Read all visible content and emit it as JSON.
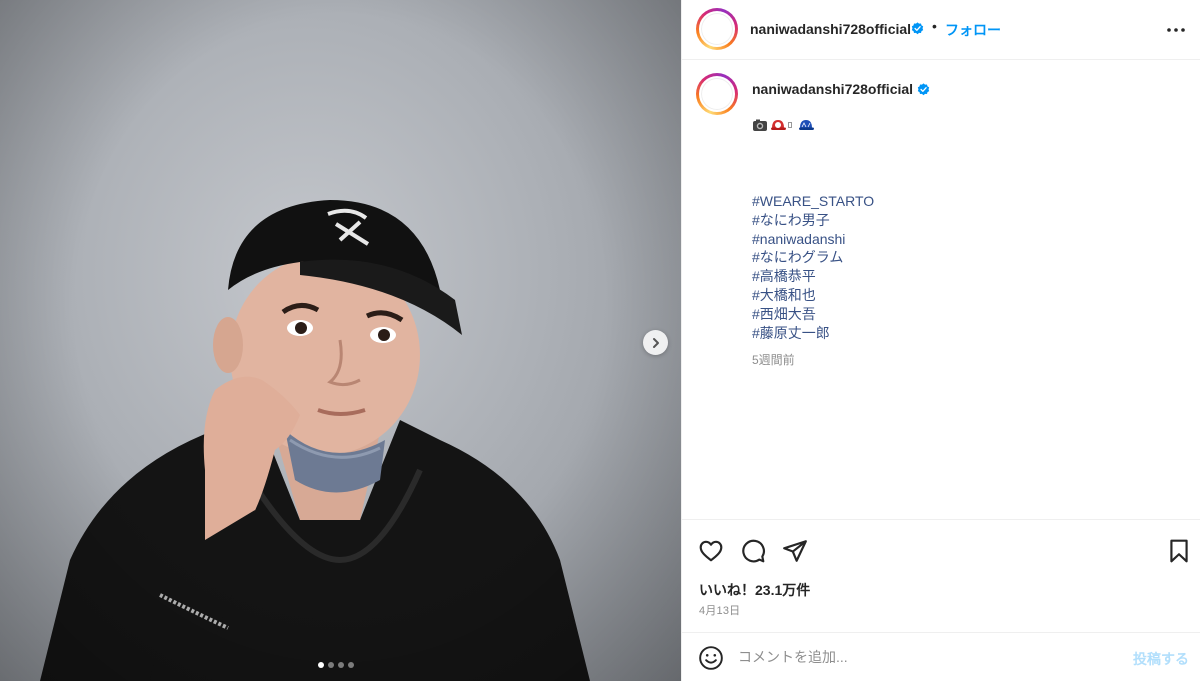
{
  "post": {
    "username": "naniwadanshi728official",
    "verified": true,
    "follow_separator": "•",
    "follow_label": "フォロー",
    "more_icon": "more-horizontal-icon",
    "caption": {
      "username": "naniwadanshi728official",
      "emojis": [
        "camera-emoji",
        "red-cap-emoji",
        "missing-glyph",
        "blue-cap-emoji"
      ],
      "hashtags": [
        "#WEARE_STARTO",
        "#なにわ男子",
        "#naniwadanshi",
        "#なにわグラム",
        "#高橋恭平",
        "#大橋和也",
        "#西畑大吾",
        "#藤原丈一郎"
      ],
      "time_ago": "5週間前"
    },
    "carousel": {
      "total": 4,
      "current": 1
    },
    "likes_label": "いいね！",
    "likes_count": "23.1万件",
    "date": "4月13日",
    "comment": {
      "placeholder": "コメントを追加...",
      "post_label": "投稿する"
    }
  },
  "colors": {
    "accent": "#0095f6",
    "hashtag": "#385185",
    "muted": "#8e8e8e",
    "post_disabled": "#b2dffc",
    "verified": "#0095f6"
  }
}
